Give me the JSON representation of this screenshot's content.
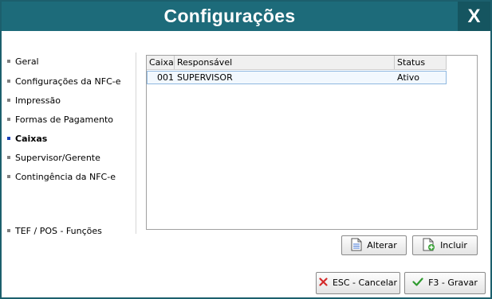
{
  "window": {
    "title": "Configurações",
    "close_glyph": "X"
  },
  "sidebar": {
    "items": [
      {
        "label": "Geral"
      },
      {
        "label": "Configurações da NFC-e"
      },
      {
        "label": "Impressão"
      },
      {
        "label": "Formas de Pagamento"
      },
      {
        "label": "Caixas",
        "active": true
      },
      {
        "label": "Supervisor/Gerente"
      },
      {
        "label": "Contingência da NFC-e"
      },
      {
        "label": "TEF / POS - Funções"
      }
    ]
  },
  "grid": {
    "columns": [
      "Caixa",
      "Responsável",
      "Status"
    ],
    "rows": [
      {
        "caixa": "001",
        "responsavel": "SUPERVISOR",
        "status": "Ativo"
      }
    ]
  },
  "actions": {
    "alterar_label": "Alterar",
    "incluir_label": "Incluir"
  },
  "footer": {
    "cancel_label": "ESC - Cancelar",
    "save_label": "F3 - Gravar"
  },
  "colors": {
    "titlebar": "#1d6b7a",
    "close_bg": "#155560",
    "active_bullet": "#1a3fb5"
  },
  "icons": [
    "close-icon",
    "document-icon",
    "document-add-icon",
    "cancel-x-icon",
    "checkmark-icon"
  ]
}
